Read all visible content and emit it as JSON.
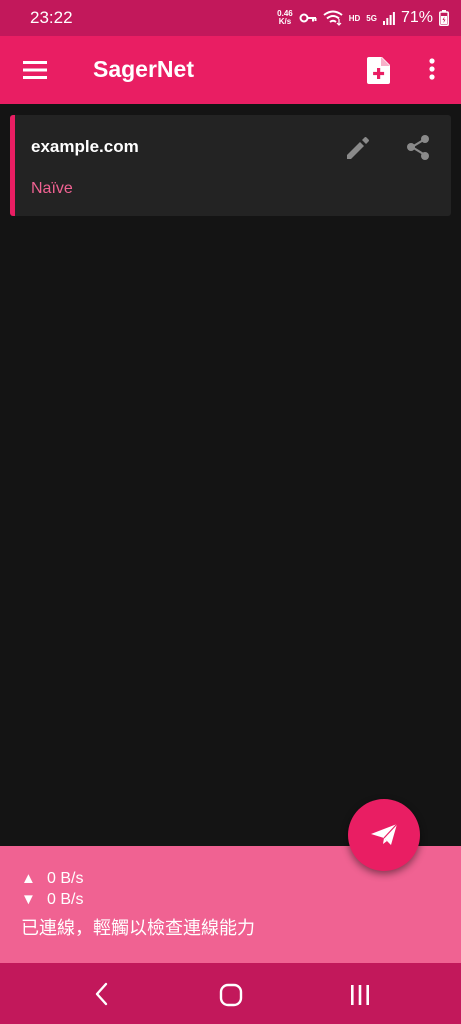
{
  "status_bar": {
    "time": "23:22",
    "net_speed_value": "0.46",
    "net_speed_unit": "K/s",
    "hd_label": "HD",
    "network_label": "5G",
    "battery": "71%",
    "icons": [
      "vpn-key-icon",
      "wifi-icon",
      "signal-icon",
      "battery-charging-icon"
    ]
  },
  "app_bar": {
    "title": "SagerNet",
    "icons": [
      "menu-icon",
      "add-profile-icon",
      "more-vert-icon"
    ]
  },
  "profiles": [
    {
      "name": "example.com",
      "type": "Naïve",
      "selected": true
    }
  ],
  "stats": {
    "upload": "0 B/s",
    "download": "0 B/s",
    "up_arrow": "▲",
    "down_arrow": "▼",
    "status_text": "已連線，輕觸以檢查連線能力"
  },
  "colors": {
    "primary": "#e91e63",
    "primary_dark": "#c2185b",
    "accent_light": "#f06292",
    "background": "#141414",
    "card": "#232323"
  }
}
